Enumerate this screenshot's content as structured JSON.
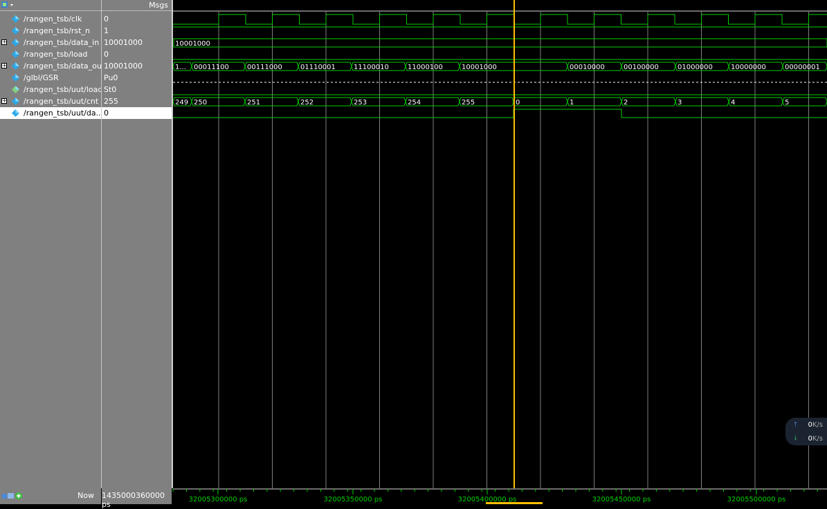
{
  "header": {
    "msgs_label": "Msgs"
  },
  "signals": [
    {
      "name": "/rangen_tsb/clk",
      "value": "0",
      "expandable": false
    },
    {
      "name": "/rangen_tsb/rst_n",
      "value": "1",
      "expandable": false
    },
    {
      "name": "/rangen_tsb/data_in",
      "value": "10001000",
      "expandable": true
    },
    {
      "name": "/rangen_tsb/load",
      "value": "0",
      "expandable": false
    },
    {
      "name": "/rangen_tsb/data_out",
      "value": "10001000",
      "expandable": true
    },
    {
      "name": "/glbl/GSR",
      "value": "Pu0",
      "expandable": false
    },
    {
      "name": "/rangen_tsb/uut/load",
      "value": "St0",
      "expandable": false
    },
    {
      "name": "/rangen_tsb/uut/cnt",
      "value": "255",
      "expandable": true
    },
    {
      "name": "/rangen_tsb/uut/da...",
      "value": "0",
      "expandable": false
    }
  ],
  "wave_labels": {
    "data_in": [
      "10001000"
    ],
    "data_out": [
      "1...",
      "00011100",
      "00111000",
      "01110001",
      "11100010",
      "11000100",
      "10001000",
      "00010000",
      "00100000",
      "01000000",
      "10000000",
      "00000001"
    ],
    "cnt": [
      "249",
      "250",
      "251",
      "252",
      "253",
      "254",
      "255",
      "0",
      "1",
      "2",
      "3",
      "4",
      "5"
    ]
  },
  "time_axis": [
    "32005300000 ps",
    "32005350000 ps",
    "32005400000 ps",
    "32005450000 ps",
    "32005500000 ps"
  ],
  "status": {
    "now_label": "Now",
    "now_value": "1435000360000 ps"
  },
  "network": {
    "up": "0",
    "down": "0",
    "unit": "K/s"
  },
  "colors": {
    "wave": "#00d000",
    "cursor": "#ffc000",
    "grid": "#808080",
    "background": "#000000",
    "panel": "#808080"
  }
}
